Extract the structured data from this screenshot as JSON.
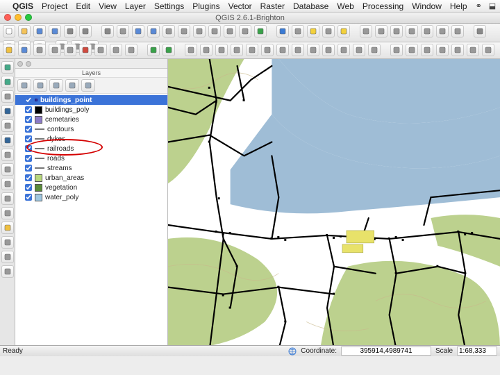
{
  "menubar": {
    "apple_glyph": "",
    "app_name": "QGIS",
    "items": [
      "Project",
      "Edit",
      "View",
      "Layer",
      "Settings",
      "Plugins",
      "Vector",
      "Raster",
      "Database",
      "Web",
      "Processing",
      "Window",
      "Help"
    ],
    "right_icons": [
      "link-icon",
      "dropbox-icon",
      "display-icon",
      "battery-icon",
      "clock-icon",
      "search-icon",
      "menu-icon"
    ]
  },
  "window": {
    "title": "QGIS 2.6.1-Brighton"
  },
  "toolbar_row1": [
    "new-project",
    "open-project",
    "save-project",
    "save-as",
    "print-composer",
    "composer-manager",
    "sep",
    "pan",
    "pan-to-selection",
    "zoom-in",
    "zoom-out",
    "zoom-native",
    "zoom-full",
    "zoom-selection",
    "zoom-layer",
    "zoom-last",
    "zoom-next",
    "refresh",
    "sep",
    "identify",
    "run-feature-action",
    "select",
    "select-polygon",
    "deselect",
    "sep",
    "measure-line",
    "measure-area",
    "measure-angle",
    "map-tips",
    "bookmark-new",
    "bookmark-show",
    "text-annotation",
    "sep",
    "csw",
    "python-console",
    "help",
    "metasearch",
    "sep",
    "label-tool",
    "diagram",
    "render-settings"
  ],
  "toolbar_row2": [
    "edit-toggle",
    "save-edits",
    "add-feature",
    "move-feature",
    "node-tool",
    "delete-selected",
    "cut-features",
    "copy-features",
    "paste-features",
    "sep",
    "undo",
    "redo",
    "sep",
    "simplify",
    "add-ring",
    "add-part",
    "fill-ring",
    "delete-ring",
    "delete-part",
    "reshape",
    "offset-curve",
    "split-features",
    "split-parts",
    "merge-features",
    "merge-attrs",
    "rotate-feature",
    "sep",
    "advanced-1",
    "advanced-2",
    "advanced-3",
    "advanced-4",
    "advanced-5",
    "advanced-6",
    "advanced-7",
    "advanced-8",
    "advanced-9",
    "advanced-10",
    "advanced-11"
  ],
  "left_dock_icons": [
    "add-vector-layer",
    "add-raster-layer",
    "add-spatialite",
    "add-postgis",
    "add-mssql",
    "add-wms",
    "add-wcs",
    "add-wfs",
    "add-delimited-text",
    "add-virtual-layer",
    "add-oracle",
    "new-shapefile",
    "new-spatialite",
    "new-geopackage",
    "gps-tools"
  ],
  "layers_panel": {
    "title": "Layers",
    "tool_icons": [
      "add-group",
      "manage-visibility",
      "filter-legend",
      "expand-all",
      "collapse-all"
    ],
    "layers": [
      {
        "name": "buildings_point",
        "checked": true,
        "selected": true,
        "swatch": "point"
      },
      {
        "name": "buildings_poly",
        "checked": true,
        "swatch": "sw-black"
      },
      {
        "name": "cemetaries",
        "checked": true,
        "swatch": "sw-purple"
      },
      {
        "name": "contours",
        "checked": true,
        "swatch": "line"
      },
      {
        "name": "dykes",
        "checked": true,
        "swatch": "line"
      },
      {
        "name": "railroads",
        "checked": true,
        "swatch": "line",
        "highlighted": true
      },
      {
        "name": "roads",
        "checked": true,
        "swatch": "line"
      },
      {
        "name": "streams",
        "checked": true,
        "swatch": "line"
      },
      {
        "name": "urban_areas",
        "checked": true,
        "swatch": "sw-green"
      },
      {
        "name": "vegetation",
        "checked": true,
        "swatch": "sw-dgreen"
      },
      {
        "name": "water_poly",
        "checked": true,
        "swatch": "sw-blue"
      }
    ]
  },
  "statusbar": {
    "ready": "Ready",
    "coord_label": "Coordinate:",
    "coord_value": "395914,4989741",
    "scale_label": "Scale",
    "scale_value": "1:68,333"
  },
  "icon_colors": {
    "new-project": "#fff",
    "open-project": "#f4c35a",
    "save-project": "#5a8ad6",
    "save-as": "#5a8ad6",
    "print-composer": "#888",
    "composer-manager": "#888",
    "pan": "#888",
    "zoom-in": "#5a8ad6",
    "zoom-out": "#5a8ad6",
    "refresh": "#39a24a",
    "identify": "#3a7bd5",
    "select": "#f3d13c",
    "deselect": "#f3d13c",
    "csw": "#888",
    "python-console": "#3a7bd5",
    "help": "#3a7bd5",
    "edit-toggle": "#f0c040",
    "save-edits": "#5a8ad6",
    "delete-selected": "#d04a3f",
    "undo": "#39a24a",
    "redo": "#39a24a",
    "add-vector-layer": "#4a8",
    "add-raster-layer": "#4a8",
    "add-postgis": "#336699",
    "add-wms": "#336699",
    "new-shapefile": "#f0c040"
  }
}
